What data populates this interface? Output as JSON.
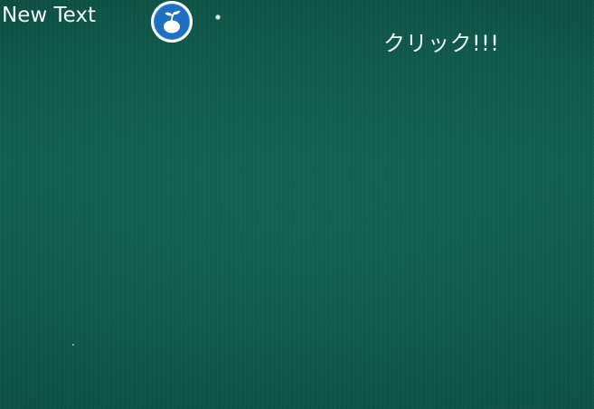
{
  "hud": {
    "score_label": "New Text",
    "sprout_icon": "sprout-seed-icon",
    "click_prompt": "クリック!!!"
  },
  "colors": {
    "background": "#0f5a4c",
    "text": "#f4f8f7",
    "button_blue": "#1f6fc2",
    "button_ring": "#ffffff"
  }
}
